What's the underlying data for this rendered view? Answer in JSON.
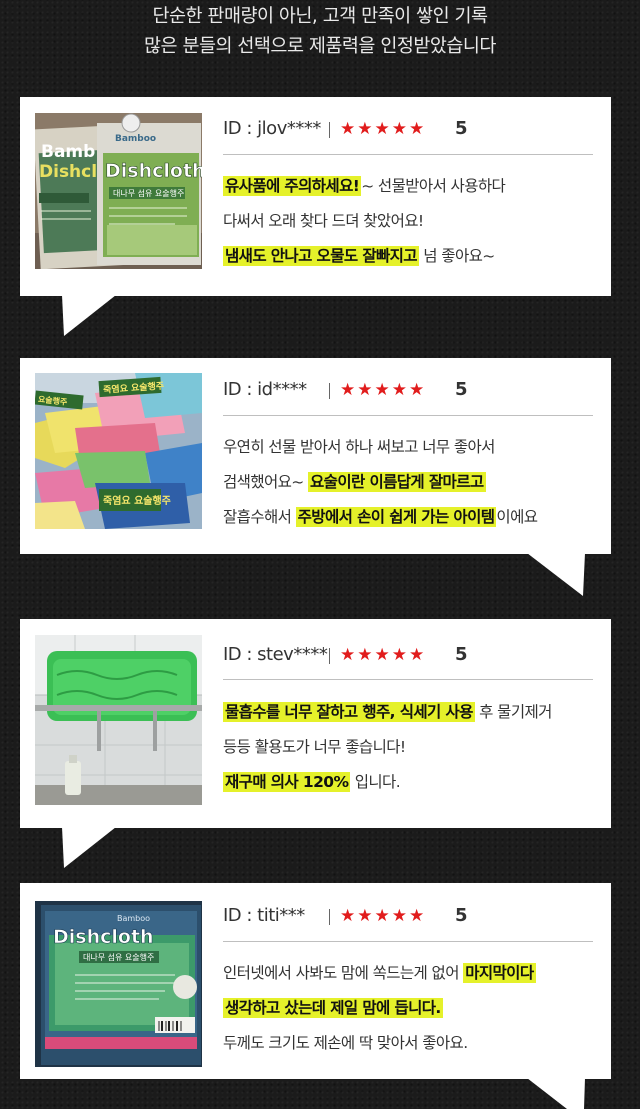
{
  "header": {
    "line1": "단순한 판매량이 아닌, 고객 만족이 쌓인 기록",
    "line2": "많은 분들의 선택으로 제품력을 인정받았습니다"
  },
  "star_glyphs": "★★★★★",
  "colors": {
    "highlight": "#e5f12a",
    "star": "#e11c1c",
    "card": "#ffffff",
    "background": "#1b1b1b"
  },
  "reviews": [
    {
      "id": "ID : jlov****",
      "rating": 5,
      "score": "5",
      "lines": [
        [
          {
            "t": "유사품에 주의하세요!",
            "hl": true
          },
          {
            "t": "~ 선물받아서 사용하다",
            "hl": false
          }
        ],
        [
          {
            "t": "다써서 오래 찾다 드뎌 찾았어요!",
            "hl": false
          }
        ],
        [
          {
            "t": "냄새도 안나고 오물도 잘빠지고",
            "hl": true
          },
          {
            "t": " 넘 좋아요~",
            "hl": false
          }
        ]
      ],
      "photo": {
        "brand": "Bamboo",
        "title": "Dishcloth",
        "kr": "대나무 섬유 요술행주"
      }
    },
    {
      "id": "ID : id****",
      "rating": 5,
      "score": "5",
      "lines": [
        [
          {
            "t": "우연히 선물 받아서 하나 써보고 너무 좋아서",
            "hl": false
          }
        ],
        [
          {
            "t": "검색했어요~ ",
            "hl": false
          },
          {
            "t": "요술이란 이름답게 잘마르고",
            "hl": true
          }
        ],
        [
          {
            "t": "잘흡수해서 ",
            "hl": false
          },
          {
            "t": "주방에서 손이 쉽게 가는 아이템",
            "hl": true
          },
          {
            "t": "이에요",
            "hl": false
          }
        ]
      ],
      "photo": {
        "label": "죽염요 요술행주"
      }
    },
    {
      "id": "ID : stev****",
      "rating": 5,
      "score": "5",
      "lines": [
        [
          {
            "t": "물흡수를 너무 잘하고 행주, 식세기 사용",
            "hl": true
          },
          {
            "t": " 후 물기제거",
            "hl": false
          }
        ],
        [
          {
            "t": "등등 활용도가 너무 좋습니다!",
            "hl": false
          }
        ],
        [
          {
            "t": "재구매 의사 120%",
            "hl": true
          },
          {
            "t": " 입니다.",
            "hl": false
          }
        ]
      ],
      "photo": {}
    },
    {
      "id": "ID : titi***",
      "rating": 5,
      "score": "5",
      "lines": [
        [
          {
            "t": "인터넷에서 사봐도 맘에 쏙드는게 없어 ",
            "hl": false
          },
          {
            "t": "마지막이다",
            "hl": true
          }
        ],
        [
          {
            "t": "생각하고 샀는데 제일 맘에 듭니다.",
            "hl": true
          }
        ],
        [
          {
            "t": "두께도 크기도 제손에 딱 맞아서 좋아요.",
            "hl": false
          }
        ]
      ],
      "photo": {
        "brand": "Bamboo",
        "title": "Dishcloth",
        "kr": "대나무 섬유 요술행주"
      }
    }
  ]
}
